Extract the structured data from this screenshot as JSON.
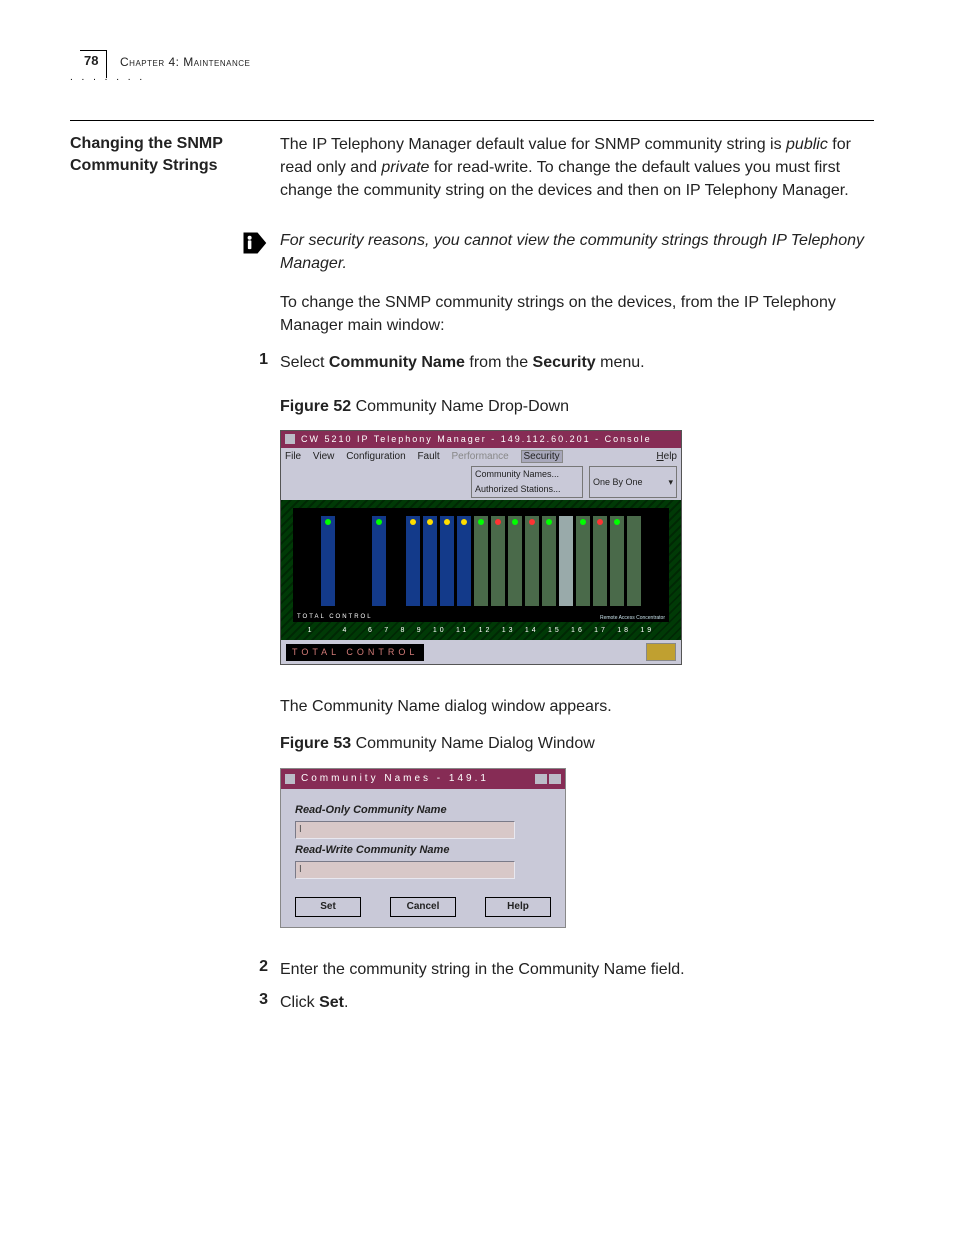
{
  "page": {
    "number": "78",
    "chapter_label": "Chapter 4: Maintenance"
  },
  "section": {
    "title": "Changing the SNMP Community Strings"
  },
  "intro": {
    "t1": "The IP Telephony Manager default value for SNMP community string is ",
    "em1": "public",
    "t2": " for read only and ",
    "em2": "private",
    "t3": " for read-write. To change the default values you must first change the community string on the devices and then on IP Telephony Manager."
  },
  "note": "For security reasons, you cannot view the community strings through IP Telephony Manager.",
  "lead_in": "To change the SNMP community strings on the devices, from the IP Telephony Manager main window:",
  "step1": {
    "num": "1",
    "a": "Select ",
    "b": "Community Name",
    "c": " from the ",
    "d": "Security",
    "e": " menu."
  },
  "fig52": {
    "caption_bold": "Figure 52",
    "caption_rest": "   Community Name Drop-Down",
    "title": "CW 5210 IP Telephony Manager - 149.112.60.201 - Console",
    "menu": {
      "file": "File",
      "view": "View",
      "config": "Configuration",
      "fault": "Fault",
      "perf": "Performance",
      "sec": "Security",
      "help": "Help"
    },
    "popup": {
      "l1": "Community Names...",
      "l2": "Authorized Stations..."
    },
    "combo": "One By One",
    "chassis_label": "TOTAL CONTROL",
    "rac": "Remote Access Concentrator",
    "slots": [
      "1",
      "4",
      "6",
      "7",
      "8",
      "9",
      "10",
      "11",
      "12",
      "13",
      "14",
      "15",
      "16",
      "17",
      "18",
      "19"
    ],
    "footer_brand": "TOTAL CONTROL"
  },
  "after52": "The Community Name dialog window appears.",
  "fig53": {
    "caption_bold": "Figure 53",
    "caption_rest": "   Community Name Dialog Window",
    "title": "Community Names - 149.1",
    "label_ro": "Read-Only Community Name",
    "label_rw": "Read-Write Community Name",
    "cursor": "I",
    "btn_set": "Set",
    "btn_cancel": "Cancel",
    "btn_help": "Help"
  },
  "step2": {
    "num": "2",
    "text": "Enter the community string in the Community Name field."
  },
  "step3": {
    "num": "3",
    "a": "Click ",
    "b": "Set",
    "c": "."
  }
}
